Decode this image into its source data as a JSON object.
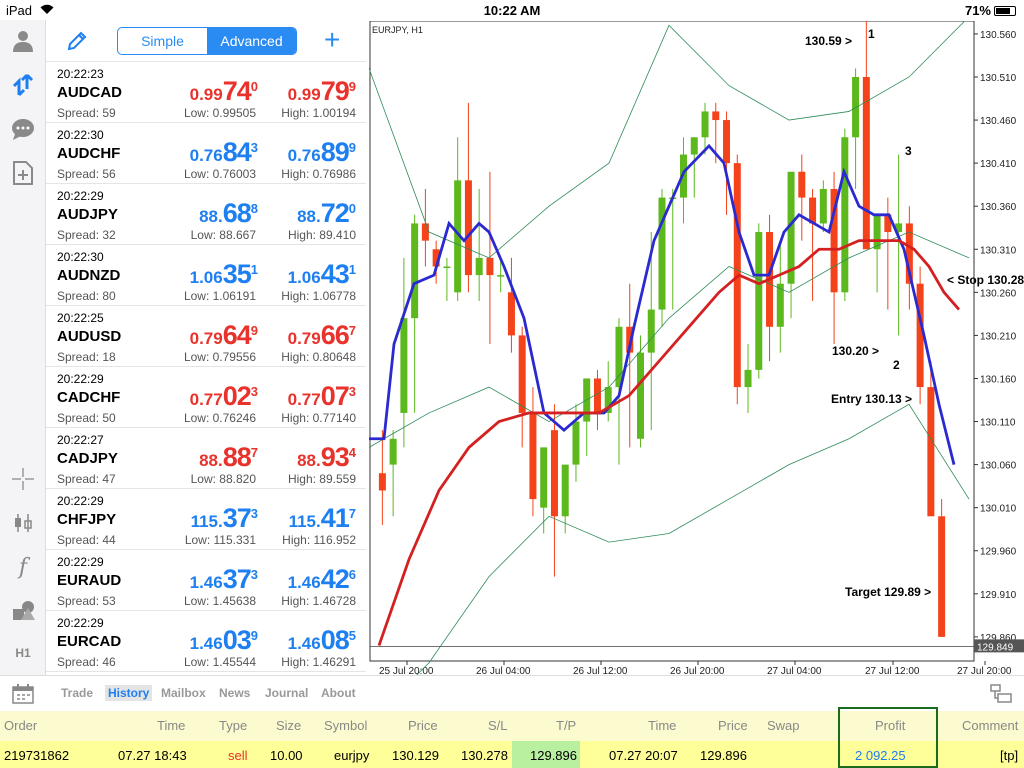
{
  "status": {
    "device": "iPad",
    "time": "10:22 AM",
    "battery": "71%"
  },
  "header": {
    "simple_label": "Simple",
    "advanced_label": "Advanced",
    "add_label": "+"
  },
  "quotes": [
    {
      "time": "20:22:23",
      "symbol": "AUDCAD",
      "bid": [
        "0.99",
        "74",
        "0"
      ],
      "ask": [
        "0.99",
        "79",
        "9"
      ],
      "spread": "Spread: 59",
      "low": "Low: 0.99505",
      "high": "High: 1.00194",
      "dir": "red"
    },
    {
      "time": "20:22:30",
      "symbol": "AUDCHF",
      "bid": [
        "0.76",
        "84",
        "3"
      ],
      "ask": [
        "0.76",
        "89",
        "9"
      ],
      "spread": "Spread: 56",
      "low": "Low: 0.76003",
      "high": "High: 0.76986",
      "dir": "blue"
    },
    {
      "time": "20:22:29",
      "symbol": "AUDJPY",
      "bid": [
        "88.",
        "68",
        "8"
      ],
      "ask": [
        "88.",
        "72",
        "0"
      ],
      "spread": "Spread: 32",
      "low": "Low: 88.667",
      "high": "High: 89.410",
      "dir": "blue"
    },
    {
      "time": "20:22:30",
      "symbol": "AUDNZD",
      "bid": [
        "1.06",
        "35",
        "1"
      ],
      "ask": [
        "1.06",
        "43",
        "1"
      ],
      "spread": "Spread: 80",
      "low": "Low: 1.06191",
      "high": "High: 1.06778",
      "dir": "blue"
    },
    {
      "time": "20:22:25",
      "symbol": "AUDUSD",
      "bid": [
        "0.79",
        "64",
        "9"
      ],
      "ask": [
        "0.79",
        "66",
        "7"
      ],
      "spread": "Spread: 18",
      "low": "Low: 0.79556",
      "high": "High: 0.80648",
      "dir": "red"
    },
    {
      "time": "20:22:29",
      "symbol": "CADCHF",
      "bid": [
        "0.77",
        "02",
        "3"
      ],
      "ask": [
        "0.77",
        "07",
        "3"
      ],
      "spread": "Spread: 50",
      "low": "Low: 0.76246",
      "high": "High: 0.77140",
      "dir": "red"
    },
    {
      "time": "20:22:27",
      "symbol": "CADJPY",
      "bid": [
        "88.",
        "88",
        "7"
      ],
      "ask": [
        "88.",
        "93",
        "4"
      ],
      "spread": "Spread: 47",
      "low": "Low: 88.820",
      "high": "High: 89.559",
      "dir": "red"
    },
    {
      "time": "20:22:29",
      "symbol": "CHFJPY",
      "bid": [
        "115.",
        "37",
        "3"
      ],
      "ask": [
        "115.",
        "41",
        "7"
      ],
      "spread": "Spread: 44",
      "low": "Low: 115.331",
      "high": "High: 116.952",
      "dir": "blue"
    },
    {
      "time": "20:22:29",
      "symbol": "EURAUD",
      "bid": [
        "1.46",
        "37",
        "3"
      ],
      "ask": [
        "1.46",
        "42",
        "6"
      ],
      "spread": "Spread: 53",
      "low": "Low: 1.45638",
      "high": "High: 1.46728",
      "dir": "blue"
    },
    {
      "time": "20:22:29",
      "symbol": "EURCAD",
      "bid": [
        "1.46",
        "03",
        "9"
      ],
      "ask": [
        "1.46",
        "08",
        "5"
      ],
      "spread": "Spread: 46",
      "low": "Low: 1.45544",
      "high": "High: 1.46291",
      "dir": "blue"
    }
  ],
  "chart": {
    "symbol_label": "EURJPY, H1",
    "y_ticks": [
      "130.560",
      "130.510",
      "130.460",
      "130.410",
      "130.360",
      "130.310",
      "130.260",
      "130.210",
      "130.160",
      "130.110",
      "130.060",
      "130.010",
      "129.960",
      "129.910",
      "129.860"
    ],
    "x_ticks": [
      "25 Jul 20:00",
      "26 Jul 04:00",
      "26 Jul 12:00",
      "26 Jul 20:00",
      "27 Jul 04:00",
      "27 Jul 12:00",
      "27 Jul 20:00"
    ],
    "current_price": "129.849",
    "annotations": [
      {
        "text": "130.59 >"
      },
      {
        "text": "1"
      },
      {
        "text": "3"
      },
      {
        "text": "< Stop 130.28"
      },
      {
        "text": "130.20 >"
      },
      {
        "text": "2"
      },
      {
        "text": "Entry 130.13 >"
      },
      {
        "text": "Target 129.89 >"
      }
    ],
    "colors": {
      "bull": "#5cb81c",
      "bear": "#f4421a",
      "fast_ma": "#2a2ad0",
      "slow_ma": "#d42020",
      "bands": "#2e8b57"
    }
  },
  "tabs": [
    "Trade",
    "History",
    "Mailbox",
    "News",
    "Journal",
    "About"
  ],
  "history": {
    "headers": [
      "Order",
      "Time",
      "Type",
      "Size",
      "Symbol",
      "Price",
      "S/L",
      "T/P",
      "Time",
      "Price",
      "Swap",
      "Profit",
      "Comment"
    ],
    "row": [
      "219731862",
      "07.27 18:43",
      "sell",
      "10.00",
      "eurjpy",
      "130.129",
      "130.278",
      "129.896",
      "07.27 20:07",
      "129.896",
      "",
      "2 092.25",
      "[tp]"
    ]
  }
}
